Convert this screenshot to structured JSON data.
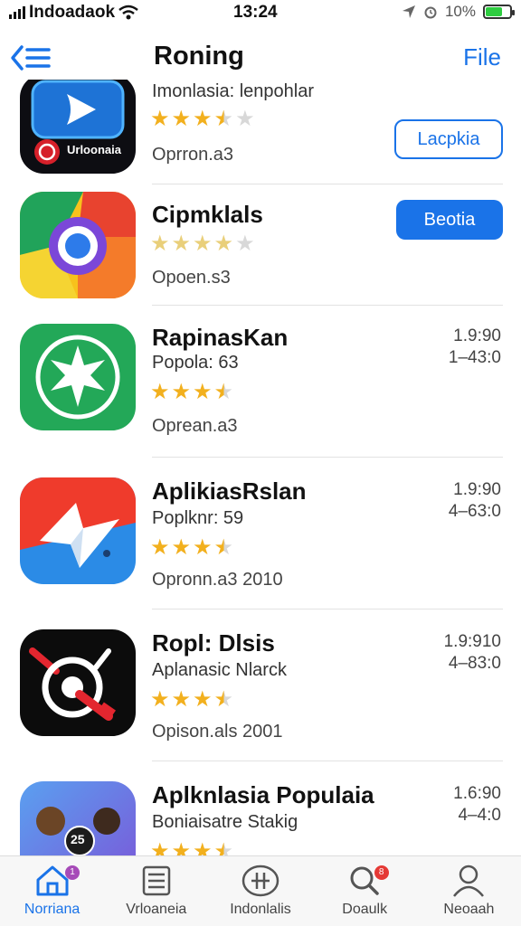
{
  "status_bar": {
    "carrier": "Indoadaok",
    "time": "13:24",
    "battery": "10%"
  },
  "nav": {
    "title": "Roning",
    "right_link": "File",
    "back_icon": "back-list-icon"
  },
  "apps": [
    {
      "name": "",
      "subtitle": "Imonlasia: lenpohlar",
      "rating": 3.5,
      "meta": "Oprron.a3",
      "action": {
        "style": "outline",
        "label": "Lacpkia"
      },
      "icon": {
        "name": "play-app-icon",
        "label": "Urloonaia"
      }
    },
    {
      "name": "Cipmklals",
      "subtitle": "",
      "rating": 0,
      "meta": "Opoen.s3",
      "action": {
        "style": "filled",
        "label": "Beotia"
      },
      "icon": {
        "name": "camera-app-icon"
      }
    },
    {
      "name": "RapinasKan",
      "subtitle": "Popola: 63",
      "rating": 3.5,
      "meta": "Oprean.a3",
      "side": [
        "1.9:90",
        "1–43:0"
      ],
      "icon": {
        "name": "star-badge-app-icon"
      }
    },
    {
      "name": "AplikiasRslan",
      "subtitle": "Poplknr: 59",
      "rating": 3.5,
      "meta": "Opronn.a3  2010",
      "side": [
        "1.9:90",
        "4–63:0"
      ],
      "icon": {
        "name": "paper-plane-app-icon"
      }
    },
    {
      "name": "Ropl: Dlsis",
      "subtitle": "Aplanasic Nlarck",
      "rating": 3.5,
      "meta": "Opison.als  2001",
      "side": [
        "1.9:910",
        "4–83:0"
      ],
      "icon": {
        "name": "stopwatch-app-icon"
      }
    },
    {
      "name": "Aplknlasia Populaia",
      "subtitle": "Boniaisatre Stakig",
      "rating": 3.5,
      "meta": "",
      "side": [
        "1.6:90",
        "4–4:0"
      ],
      "icon": {
        "name": "people-app-icon",
        "label": "25"
      }
    }
  ],
  "tabs": [
    {
      "label": "Norriana",
      "icon": "home-icon",
      "active": true,
      "badge": "1"
    },
    {
      "label": "Vrloaneia",
      "icon": "list-icon",
      "active": false
    },
    {
      "label": "Indonlalis",
      "icon": "grid-icon",
      "active": false
    },
    {
      "label": "Doaulk",
      "icon": "search-icon",
      "active": false,
      "badge": "8"
    },
    {
      "label": "Neoaah",
      "icon": "person-icon",
      "active": false
    }
  ],
  "colors": {
    "accent": "#1a73e8",
    "star": "#f2b01e",
    "battery": "#2ecc40"
  }
}
